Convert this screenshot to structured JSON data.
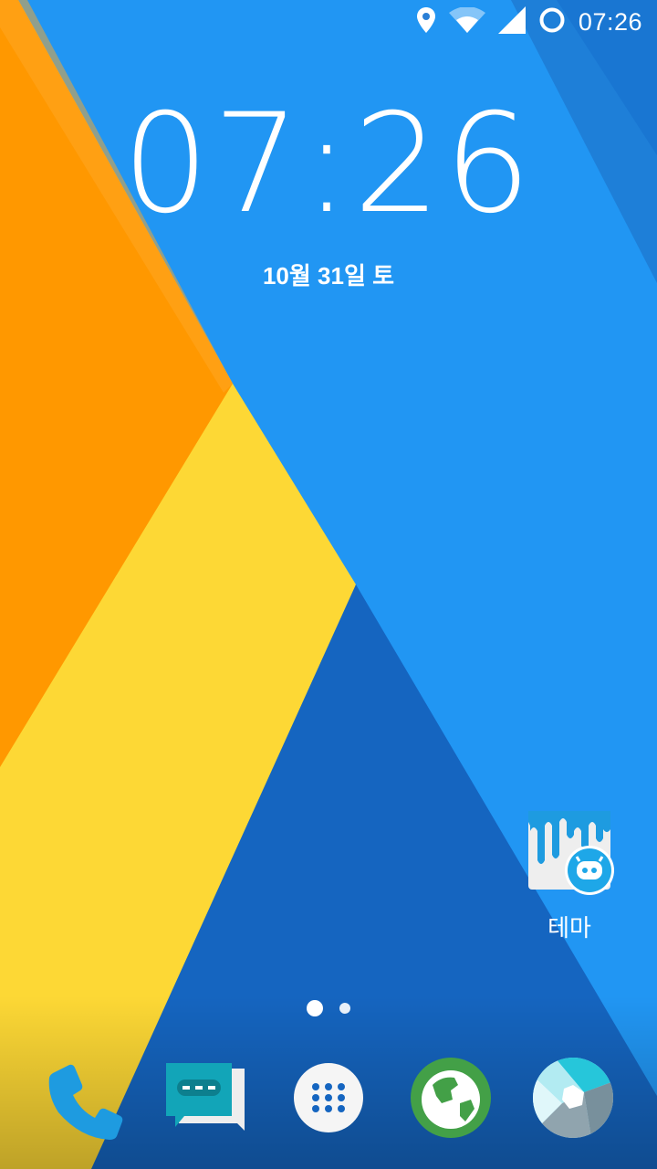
{
  "status_bar": {
    "time": "07:26",
    "icons": [
      "location-icon",
      "wifi-icon",
      "cell-signal-icon",
      "battery-ring-icon"
    ]
  },
  "clock": {
    "time": "07:26"
  },
  "date": {
    "text": "10월 31일 토"
  },
  "desktop": {
    "apps": [
      {
        "label": "테마",
        "icon": "themes-icon"
      }
    ]
  },
  "page_indicator": {
    "pages": 2,
    "active": 1
  },
  "dock": {
    "items": [
      {
        "icon": "phone-icon"
      },
      {
        "icon": "messaging-icon"
      },
      {
        "icon": "app-drawer-icon"
      },
      {
        "icon": "browser-icon"
      },
      {
        "icon": "camera-icon"
      }
    ]
  },
  "colors": {
    "orange": "#FF9800",
    "yellow": "#FDD835",
    "light_blue": "#2196F3",
    "dark_blue": "#1565C0"
  }
}
